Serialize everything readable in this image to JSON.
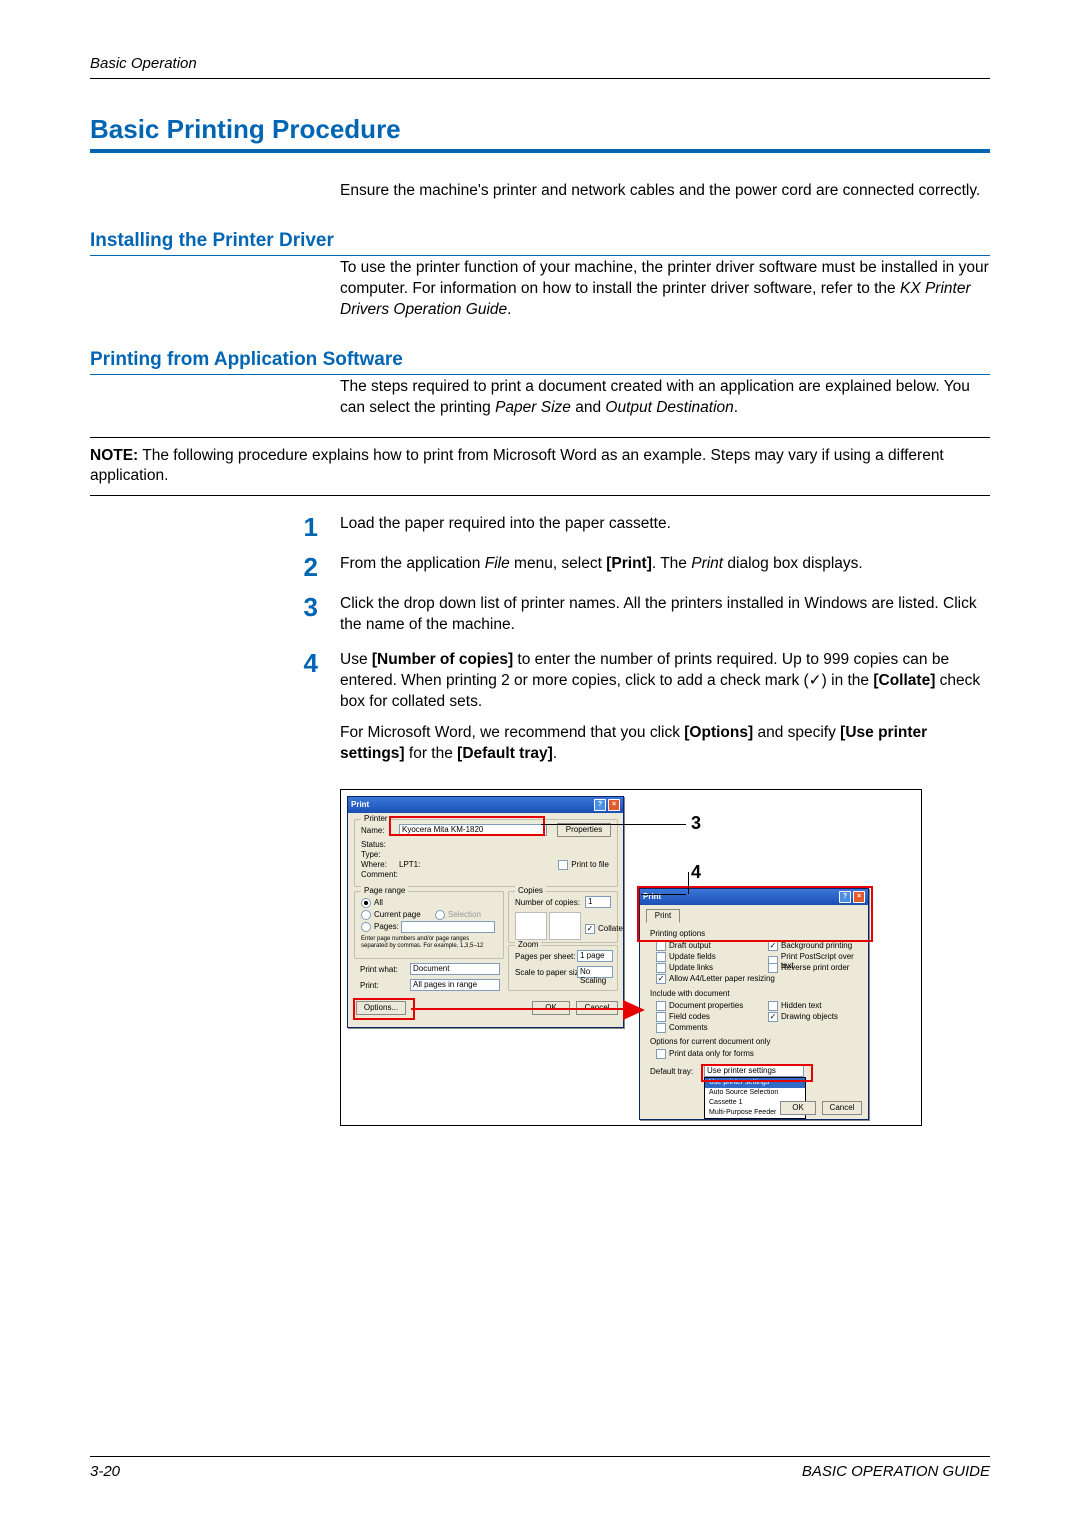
{
  "header": {
    "running": "Basic Operation"
  },
  "h1": "Basic Printing Procedure",
  "intro": "Ensure the machine's printer and network cables and the power cord are connected correctly.",
  "h2a": "Installing the Printer Driver",
  "p_install_a": "To use the printer function of your machine, the printer driver software must be installed in your computer. For information on how to install the printer driver software, refer to the ",
  "p_install_em": "KX Printer Drivers Operation Guide",
  "p_install_b": ".",
  "h2b": "Printing from Application Software",
  "p_print_a": "The steps required to print a document created with an application are explained below. You can select the printing ",
  "p_print_em1": "Paper Size",
  "p_print_mid": " and ",
  "p_print_em2": "Output Destination",
  "p_print_b": ".",
  "note_label": "NOTE:",
  "note_body": " The following procedure explains how to print from Microsoft Word as an example. Steps may vary if using a different application.",
  "steps": {
    "1": {
      "num": "1",
      "text": "Load the paper required into the paper cassette."
    },
    "2": {
      "num": "2",
      "a": "From the application ",
      "em1": "File",
      "b": " menu, select ",
      "bold1": "[Print]",
      "c": ". The ",
      "em2": "Print",
      "d": " dialog box displays."
    },
    "3": {
      "num": "3",
      "text": "Click the drop down list of printer names. All the printers installed in Windows are listed. Click the name of the machine."
    },
    "4": {
      "num": "4",
      "a": "Use ",
      "bold1": "[Number of copies]",
      "b": " to enter the number of prints required. Up to 999 copies can be entered.   When printing 2 or more copies, click to add a check mark (",
      "check": "✓",
      "c": ") in the ",
      "bold2": "[Collate]",
      "d": " check box for collated sets.",
      "p2a": "For Microsoft Word, we recommend that you click ",
      "p2bold1": "[Options]",
      "p2b": " and specify ",
      "p2bold2": "[Use printer settings]",
      "p2c": " for the ",
      "p2bold3": "[Default tray]",
      "p2d": "."
    }
  },
  "dialog1": {
    "title": "Print",
    "printer_group": "Printer",
    "name_label": "Name:",
    "name_value": "Kyocera Mita KM-1820",
    "status_label": "Status:",
    "type_label": "Type:",
    "where_label": "Where:",
    "where_value": "LPT1:",
    "comment_label": "Comment:",
    "properties_btn": "Properties",
    "print_to_file": "Print to file",
    "page_range_group": "Page range",
    "all": "All",
    "current_page": "Current page",
    "selection": "Selection",
    "pages_label": "Pages:",
    "pages_hint": "Enter page numbers and/or page ranges separated by commas. For example, 1,3,5–12",
    "copies_group": "Copies",
    "num_copies_label": "Number of copies:",
    "num_copies_value": "1",
    "collate": "Collate",
    "zoom_group": "Zoom",
    "pages_per_sheet_label": "Pages per sheet:",
    "pages_per_sheet_value": "1 page",
    "scale_label": "Scale to paper size:",
    "scale_value": "No Scaling",
    "print_what_label": "Print what:",
    "print_what_value": "Document",
    "print_label": "Print:",
    "print_value": "All pages in range",
    "options_btn": "Options...",
    "ok_btn": "OK",
    "cancel_btn": "Cancel"
  },
  "dialog2": {
    "title": "Print",
    "tab": "Print",
    "printing_options": "Printing options",
    "draft_output": "Draft output",
    "update_fields": "Update fields",
    "update_links": "Update links",
    "allow_letter": "Allow A4/Letter paper resizing",
    "background_printing": "Background printing",
    "print_postscript": "Print PostScript over text",
    "reverse_print": "Reverse print order",
    "include_with": "Include with document",
    "doc_properties": "Document properties",
    "field_codes": "Field codes",
    "comments": "Comments",
    "hidden_text": "Hidden text",
    "drawing_objects": "Drawing objects",
    "current_doc_only": "Options for current document only",
    "print_data_forms": "Print data only for forms",
    "default_tray_label": "Default tray:",
    "dropdown": {
      "opt0": "Use printer settings",
      "sel": "Use printer settings",
      "opt2": "Auto Source Selection",
      "opt3": "Cassette 1",
      "opt4": "Multi-Purpose Feeder"
    },
    "ok_btn": "OK",
    "cancel_btn": "Cancel"
  },
  "callouts": {
    "c3": "3",
    "c4": "4"
  },
  "footer": {
    "left": "3-20",
    "right": "BASIC OPERATION GUIDE"
  }
}
